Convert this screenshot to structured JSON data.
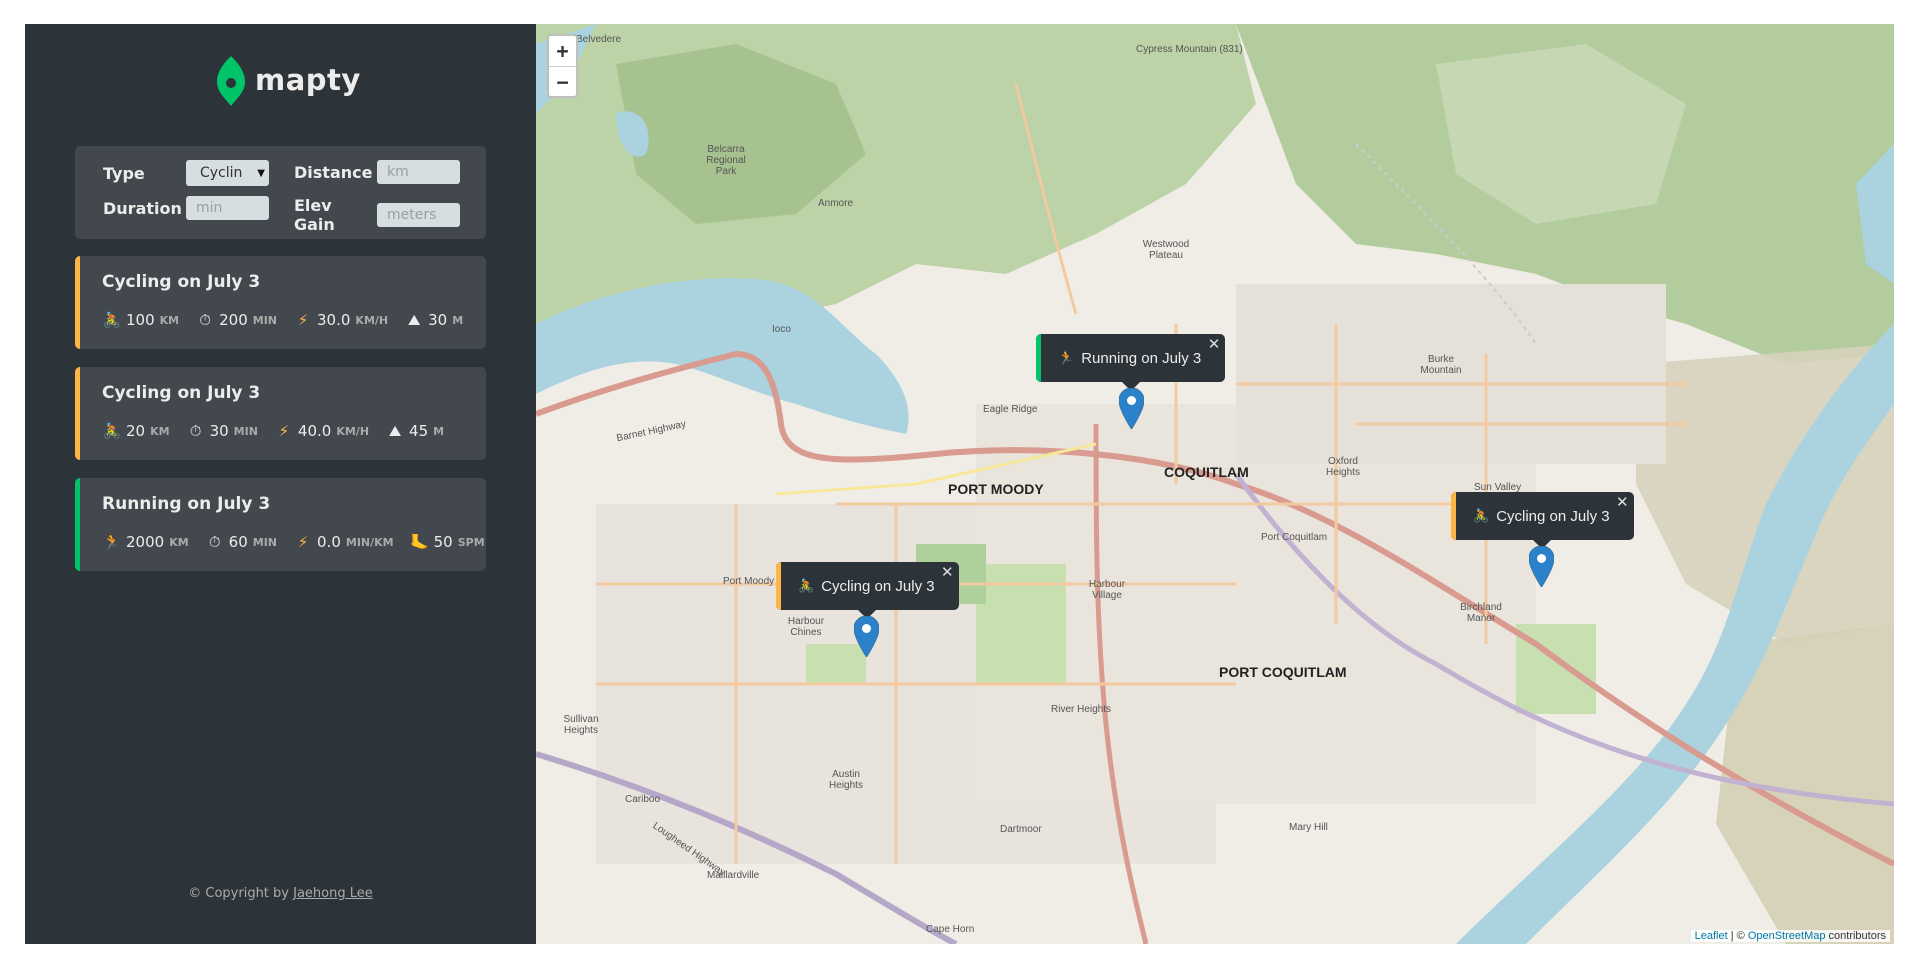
{
  "app": {
    "logo_text": "mapty",
    "brand_color": "#00c46a",
    "running_color": "#00c46a",
    "cycling_color": "#ffb545"
  },
  "form": {
    "type_label": "Type",
    "type_value": "Cyclin",
    "distance_label": "Distance",
    "distance_placeholder": "km",
    "duration_label": "Duration",
    "duration_placeholder": "min",
    "elev_label": "Elev Gain",
    "elev_placeholder": "meters"
  },
  "workouts": [
    {
      "type": "cycling",
      "title": "Cycling on July 3",
      "distance": "100",
      "distance_unit": "km",
      "duration": "200",
      "duration_unit": "min",
      "speed": "30.0",
      "speed_unit": "km/h",
      "extra": "30",
      "extra_unit": "m",
      "icons": [
        "cyclist-icon",
        "stopwatch-icon",
        "lightning-icon",
        "mountain-icon"
      ]
    },
    {
      "type": "cycling",
      "title": "Cycling on July 3",
      "distance": "20",
      "distance_unit": "km",
      "duration": "30",
      "duration_unit": "min",
      "speed": "40.0",
      "speed_unit": "km/h",
      "extra": "45",
      "extra_unit": "m",
      "icons": [
        "cyclist-icon",
        "stopwatch-icon",
        "lightning-icon",
        "mountain-icon"
      ]
    },
    {
      "type": "running",
      "title": "Running on July 3",
      "distance": "2000",
      "distance_unit": "km",
      "duration": "60",
      "duration_unit": "min",
      "speed": "0.0",
      "speed_unit": "min/km",
      "extra": "50",
      "extra_unit": "spm",
      "icons": [
        "runner-icon",
        "stopwatch-icon",
        "lightning-icon",
        "footprint-icon"
      ]
    }
  ],
  "footer": {
    "copyright_prefix": "© Copyright by",
    "author": "Jaehong Lee"
  },
  "map": {
    "zoom_in": "+",
    "zoom_out": "−",
    "attribution_leaflet": "Leaflet",
    "attribution_sep": " | © ",
    "attribution_osm": "OpenStreetMap",
    "attribution_suffix": " contributors",
    "popups": [
      {
        "type": "running",
        "text": "Running on July 3"
      },
      {
        "type": "cycling",
        "text": "Cycling on July 3"
      },
      {
        "type": "cycling",
        "text": "Cycling on July 3"
      }
    ],
    "labels": {
      "port_moody": "PORT MOODY",
      "coquitlam": "COQUITLAM",
      "port_coquitlam": "PORT COQUITLAM",
      "belcarra": "Belcarra Regional Park",
      "westwood": "Westwood Plateau",
      "burke": "Burke Mountain",
      "eagle_ridge": "Eagle Ridge",
      "harbour_village": "Harbour Village",
      "harbour_chines": "Harbour Chines",
      "river_heights": "River Heights",
      "austin_heights": "Austin Heights",
      "sullivan_heights": "Sullivan Heights",
      "mary_hill": "Mary Hill",
      "dartmoor": "Dartmoor",
      "cape_horn": "Cape Horn",
      "maillardville": "Maillardville",
      "cariboo": "Cariboo",
      "birchland": "Birchland Manor",
      "oxford": "Oxford Heights",
      "port_coquitlam_small": "Port Coquitlam",
      "port_moody_small": "Port Moody",
      "anmore": "Anmore",
      "ioco": "Ioco",
      "sun_valley": "Sun Valley",
      "barnet": "Barnet Highway",
      "lougheed": "Lougheed Highway",
      "cypress": "Cypress Mountain (831)",
      "belvedere": "Belvedere"
    }
  }
}
